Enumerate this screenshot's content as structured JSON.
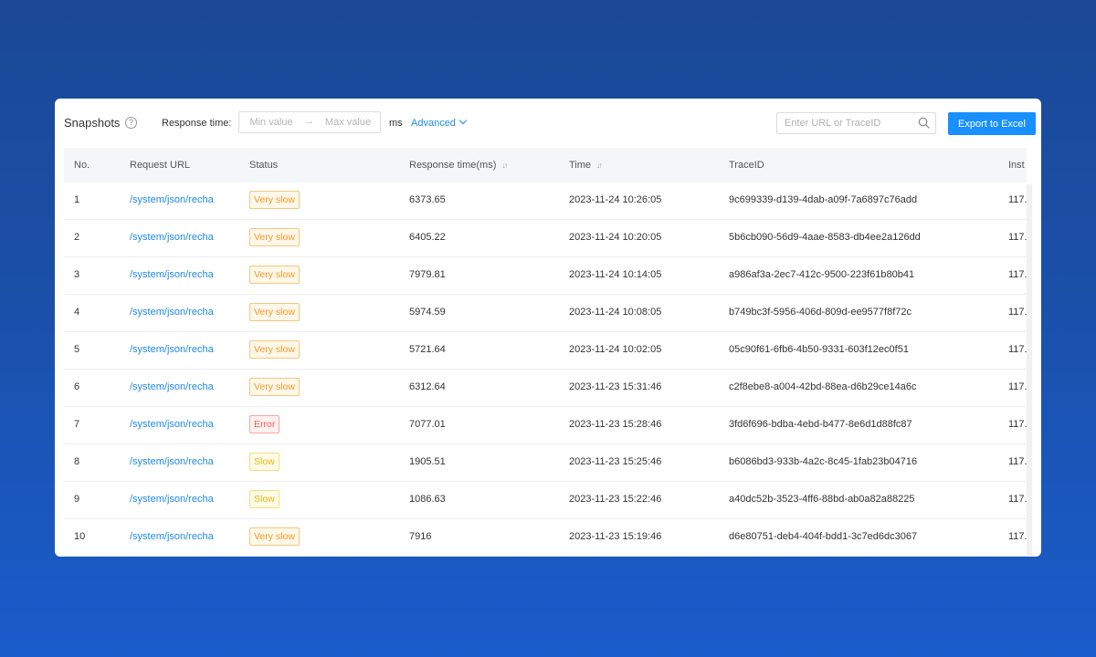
{
  "toolbar": {
    "title": "Snapshots",
    "help_glyph": "?",
    "response_time_label": "Response time:",
    "min_placeholder": "Min value",
    "max_placeholder": "Max value",
    "range_arrow": "→",
    "unit": "ms",
    "advanced_label": "Advanced",
    "search_placeholder": "Enter URL or TraceID",
    "export_label": "Export to Excel"
  },
  "colors": {
    "accent": "#1890ff",
    "link": "#1f8ae6",
    "very_slow": "#f39a2b",
    "slow": "#e8b417",
    "error": "#f0595e"
  },
  "table": {
    "headers": {
      "no": "No.",
      "url": "Request URL",
      "status": "Status",
      "response_time": "Response time(ms)",
      "time": "Time",
      "trace": "TraceID",
      "instance": "Inst"
    },
    "sort_glyph": "↓↑",
    "rows": [
      {
        "no": "1",
        "url": "/system/json/recha",
        "status": "Very slow",
        "status_type": "very-slow",
        "rt": "6373.65",
        "time": "2023-11-24 10:26:05",
        "trace": "9c699339-d139-4dab-a09f-7a6897c76add",
        "inst": "117."
      },
      {
        "no": "2",
        "url": "/system/json/recha",
        "status": "Very slow",
        "status_type": "very-slow",
        "rt": "6405.22",
        "time": "2023-11-24 10:20:05",
        "trace": "5b6cb090-56d9-4aae-8583-db4ee2a126dd",
        "inst": "117."
      },
      {
        "no": "3",
        "url": "/system/json/recha",
        "status": "Very slow",
        "status_type": "very-slow",
        "rt": "7979.81",
        "time": "2023-11-24 10:14:05",
        "trace": "a986af3a-2ec7-412c-9500-223f61b80b41",
        "inst": "117."
      },
      {
        "no": "4",
        "url": "/system/json/recha",
        "status": "Very slow",
        "status_type": "very-slow",
        "rt": "5974.59",
        "time": "2023-11-24 10:08:05",
        "trace": "b749bc3f-5956-406d-809d-ee9577f8f72c",
        "inst": "117."
      },
      {
        "no": "5",
        "url": "/system/json/recha",
        "status": "Very slow",
        "status_type": "very-slow",
        "rt": "5721.64",
        "time": "2023-11-24 10:02:05",
        "trace": "05c90f61-6fb6-4b50-9331-603f12ec0f51",
        "inst": "117."
      },
      {
        "no": "6",
        "url": "/system/json/recha",
        "status": "Very slow",
        "status_type": "very-slow",
        "rt": "6312.64",
        "time": "2023-11-23 15:31:46",
        "trace": "c2f8ebe8-a004-42bd-88ea-d6b29ce14a6c",
        "inst": "117."
      },
      {
        "no": "7",
        "url": "/system/json/recha",
        "status": "Error",
        "status_type": "error",
        "rt": "7077.01",
        "time": "2023-11-23 15:28:46",
        "trace": "3fd6f696-bdba-4ebd-b477-8e6d1d88fc87",
        "inst": "117."
      },
      {
        "no": "8",
        "url": "/system/json/recha",
        "status": "Slow",
        "status_type": "slow",
        "rt": "1905.51",
        "time": "2023-11-23 15:25:46",
        "trace": "b6086bd3-933b-4a2c-8c45-1fab23b04716",
        "inst": "117."
      },
      {
        "no": "9",
        "url": "/system/json/recha",
        "status": "Slow",
        "status_type": "slow",
        "rt": "1086.63",
        "time": "2023-11-23 15:22:46",
        "trace": "a40dc52b-3523-4ff6-88bd-ab0a82a88225",
        "inst": "117."
      },
      {
        "no": "10",
        "url": "/system/json/recha",
        "status": "Very slow",
        "status_type": "very-slow",
        "rt": "7916",
        "time": "2023-11-23 15:19:46",
        "trace": "d6e80751-deb4-404f-bdd1-3c7ed6dc3067",
        "inst": "117."
      }
    ]
  }
}
